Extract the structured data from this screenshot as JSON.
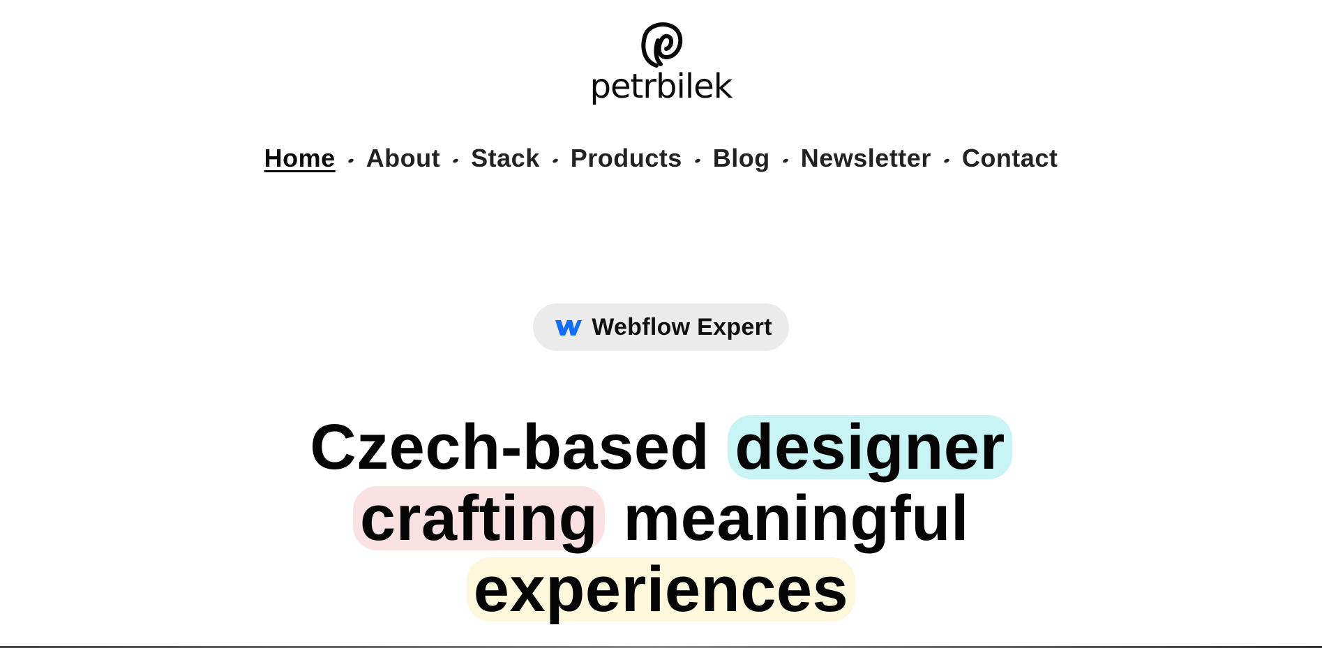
{
  "logo": {
    "text": "petrbilek",
    "mark_icon": "p-monogram-icon"
  },
  "nav": {
    "items": [
      {
        "label": "Home",
        "active": true
      },
      {
        "label": "About",
        "active": false
      },
      {
        "label": "Stack",
        "active": false
      },
      {
        "label": "Products",
        "active": false
      },
      {
        "label": "Blog",
        "active": false
      },
      {
        "label": "Newsletter",
        "active": false
      },
      {
        "label": "Contact",
        "active": false
      }
    ],
    "separator_icon": "dot-icon"
  },
  "badge": {
    "icon": "webflow-logo-icon",
    "icon_color": "#146ef5",
    "label": "Webflow Expert"
  },
  "hero": {
    "line1_plain": "Czech-based",
    "line1_highlight": "designer",
    "line2_highlight": "crafting",
    "line2_plain": "meaningful",
    "line3_highlight": "experiences",
    "highlight_colors": {
      "designer": "#c8f4f5",
      "crafting": "#fbe2e2",
      "experiences": "#fdf7dc"
    }
  }
}
